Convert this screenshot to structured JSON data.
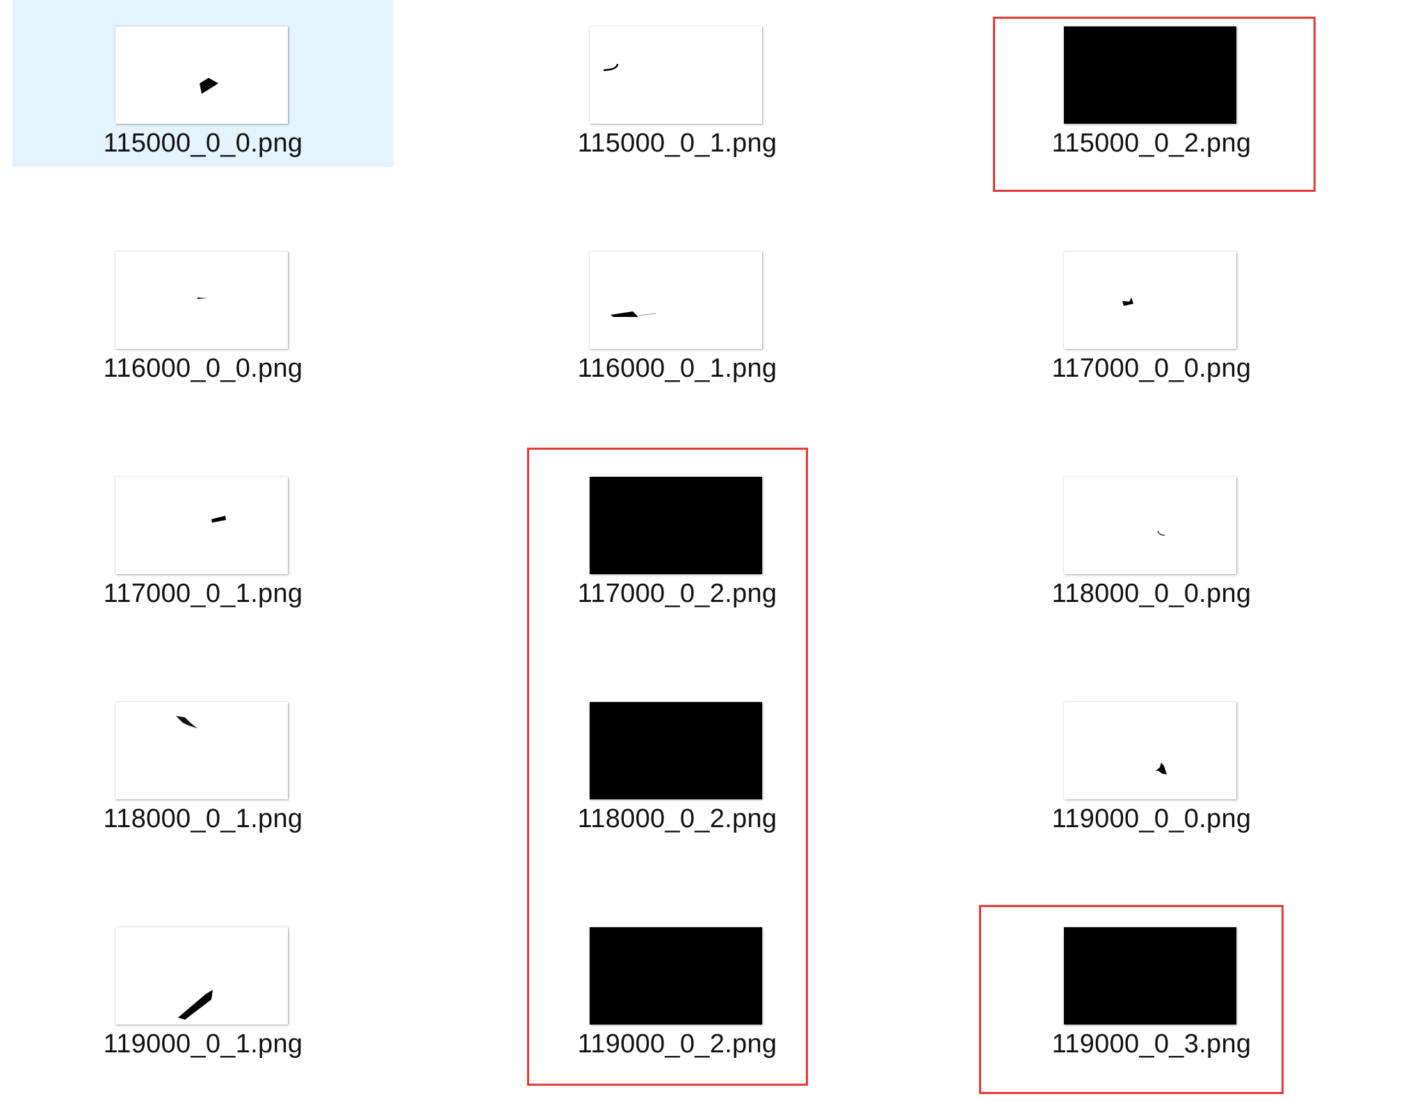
{
  "files": [
    {
      "name": "115000_0_0.png",
      "thumbnail": "small-dark-blob",
      "selected": true
    },
    {
      "name": "115000_0_1.png",
      "thumbnail": "small-curve"
    },
    {
      "name": "115000_0_2.png",
      "thumbnail": "solid-black",
      "highlighted": true
    },
    {
      "name": "116000_0_0.png",
      "thumbnail": "tiny-dash"
    },
    {
      "name": "116000_0_1.png",
      "thumbnail": "wedge"
    },
    {
      "name": "117000_0_0.png",
      "thumbnail": "small-hook"
    },
    {
      "name": "117000_0_1.png",
      "thumbnail": "short-bar"
    },
    {
      "name": "117000_0_2.png",
      "thumbnail": "solid-black",
      "highlighted": true
    },
    {
      "name": "118000_0_0.png",
      "thumbnail": "faint-speck"
    },
    {
      "name": "118000_0_1.png",
      "thumbnail": "streak"
    },
    {
      "name": "118000_0_2.png",
      "thumbnail": "solid-black",
      "highlighted": true
    },
    {
      "name": "119000_0_0.png",
      "thumbnail": "small-splat"
    },
    {
      "name": "119000_0_1.png",
      "thumbnail": "diagonal-bar"
    },
    {
      "name": "119000_0_2.png",
      "thumbnail": "solid-black",
      "highlighted": true
    },
    {
      "name": "119000_0_3.png",
      "thumbnail": "solid-black",
      "highlighted": true
    }
  ],
  "colors": {
    "selection_background": "#e5f3ff",
    "highlight_box": "#e53935"
  }
}
